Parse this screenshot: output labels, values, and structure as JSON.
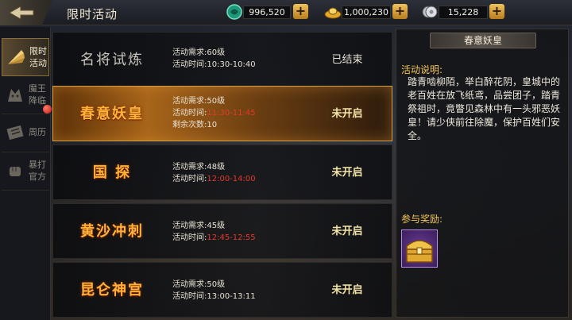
{
  "header": {
    "title": "限时活动",
    "currencies": [
      {
        "name": "jade",
        "icon": "jade-coin-icon",
        "amount": "996,520"
      },
      {
        "name": "gold-ingot",
        "icon": "gold-ingot-icon",
        "amount": "1,000,230"
      },
      {
        "name": "silver",
        "icon": "silver-coin-icon",
        "amount": "15,228"
      }
    ],
    "plus_label": "+"
  },
  "sidebar": {
    "items": [
      {
        "label_line1": "限时",
        "label_line2": "活动",
        "icon": "fan-icon",
        "active": true
      },
      {
        "label_line1": "魔王",
        "label_line2": "降临",
        "icon": "demon-icon",
        "active": false
      },
      {
        "label_line1": "周历",
        "label_line2": "",
        "icon": "scroll-icon",
        "active": false,
        "badge": true
      },
      {
        "label_line1": "暴打",
        "label_line2": "官方",
        "icon": "fist-icon",
        "active": false
      }
    ]
  },
  "activities": [
    {
      "name": "名将试炼",
      "req": "活动需求:60级",
      "time_prefix": "活动时间:",
      "time": "10:30-10:40",
      "extra": "",
      "status": "已结束"
    },
    {
      "name": "春意妖皇",
      "req": "活动需求:50级",
      "time_prefix": "活动时间:",
      "time": "11:30-11:45",
      "extra": "剩余次数:10",
      "status": "未开启"
    },
    {
      "name": "国 探",
      "req": "活动需求:48级",
      "time_prefix": "活动时间:",
      "time": "12:00-14:00",
      "extra": "",
      "status": "未开启"
    },
    {
      "name": "黄沙冲刺",
      "req": "活动需求:45级",
      "time_prefix": "活动时间:",
      "time": "12:45-12:55",
      "extra": "",
      "status": "未开启"
    },
    {
      "name": "昆仑神宫",
      "req": "活动需求:50级",
      "time_prefix": "活动时间:",
      "time": "13:00-13:11",
      "extra": "",
      "status": "未开启"
    }
  ],
  "detail": {
    "title": "春意妖皇",
    "desc_label": "活动说明:",
    "desc": "踏青啮柳陌，举白醉花阴，皇城中的老百姓在放飞纸鸢，品尝团子，踏青祭祖时，竟瞥见森林中有一头邪恶妖皇！请少侠前往除魔，保护百姓们安全。",
    "reward_label": "参与奖励:",
    "reward_icon": "treasure-chest-icon"
  },
  "colors": {
    "accent_gold": "#f3c55a",
    "time_red": "#e23a2a",
    "selected_row": "#a8651a",
    "reward_purple": "#6a3a9a"
  }
}
